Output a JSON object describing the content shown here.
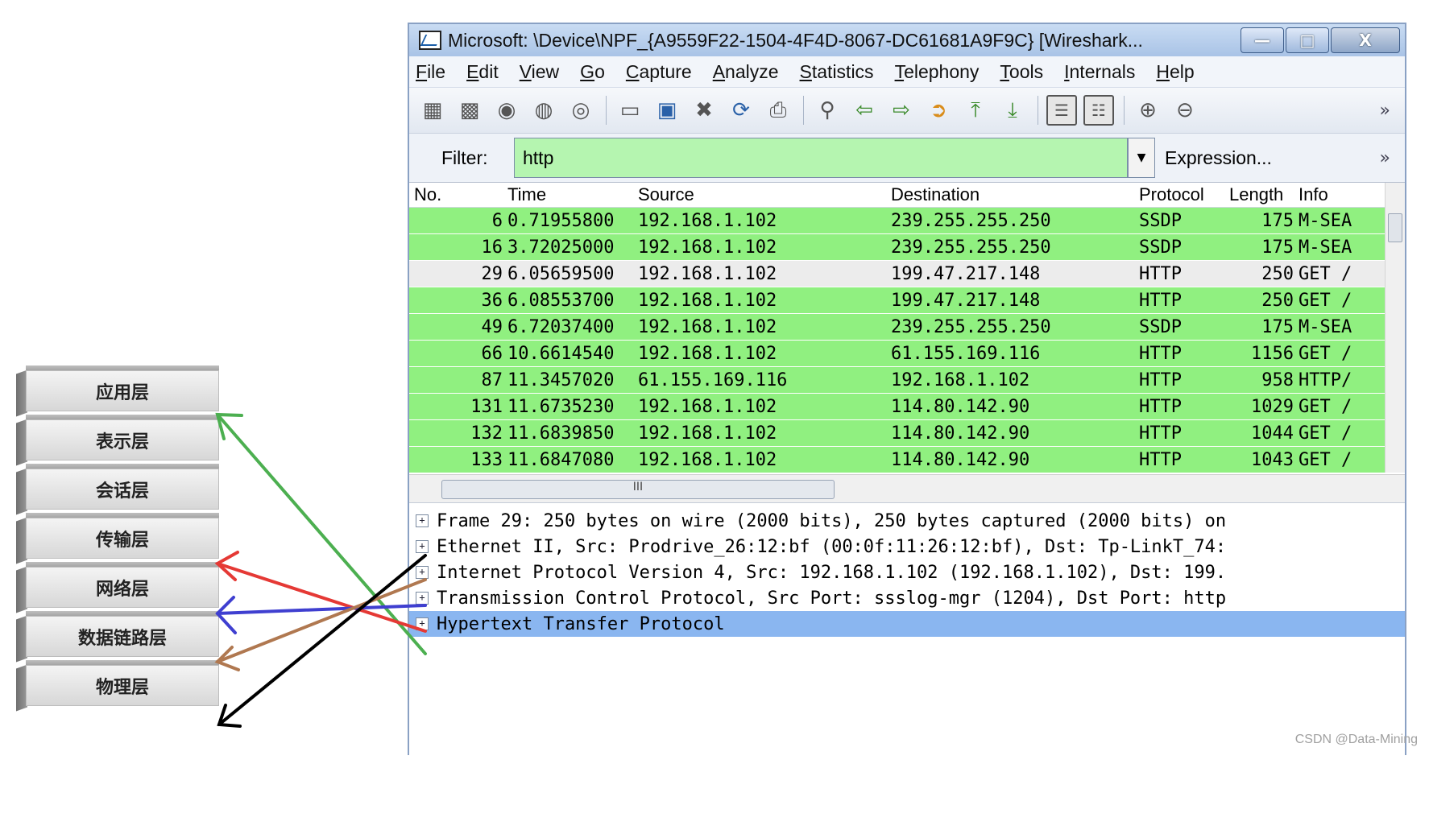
{
  "osi_layers": [
    "应用层",
    "表示层",
    "会话层",
    "传输层",
    "网络层",
    "数据链路层",
    "物理层"
  ],
  "window": {
    "title": "Microsoft: \\Device\\NPF_{A9559F22-1504-4F4D-8067-DC61681A9F9C}  [Wireshark...",
    "buttons": {
      "minimize": "—",
      "maximize": "□",
      "close": "X"
    }
  },
  "menu": [
    "File",
    "Edit",
    "View",
    "Go",
    "Capture",
    "Analyze",
    "Statistics",
    "Telephony",
    "Tools",
    "Internals",
    "Help"
  ],
  "toolbar_more": "»",
  "filter": {
    "label": "Filter:",
    "value": "http",
    "expression": "Expression...",
    "more": "»"
  },
  "columns": [
    "No.",
    "Time",
    "Source",
    "Destination",
    "Protocol",
    "Length",
    "Info"
  ],
  "packets": [
    {
      "no": "6",
      "time": "0.71955800",
      "src": "192.168.1.102",
      "dst": "239.255.255.250",
      "proto": "SSDP",
      "len": "175",
      "info": "M-SEA"
    },
    {
      "no": "16",
      "time": "3.72025000",
      "src": "192.168.1.102",
      "dst": "239.255.255.250",
      "proto": "SSDP",
      "len": "175",
      "info": "M-SEA"
    },
    {
      "no": "29",
      "time": "6.05659500",
      "src": "192.168.1.102",
      "dst": "199.47.217.148",
      "proto": "HTTP",
      "len": "250",
      "info": "GET /"
    },
    {
      "no": "36",
      "time": "6.08553700",
      "src": "192.168.1.102",
      "dst": "199.47.217.148",
      "proto": "HTTP",
      "len": "250",
      "info": "GET /"
    },
    {
      "no": "49",
      "time": "6.72037400",
      "src": "192.168.1.102",
      "dst": "239.255.255.250",
      "proto": "SSDP",
      "len": "175",
      "info": "M-SEA"
    },
    {
      "no": "66",
      "time": "10.6614540",
      "src": "192.168.1.102",
      "dst": "61.155.169.116",
      "proto": "HTTP",
      "len": "1156",
      "info": "GET /"
    },
    {
      "no": "87",
      "time": "11.3457020",
      "src": "61.155.169.116",
      "dst": "192.168.1.102",
      "proto": "HTTP",
      "len": "958",
      "info": "HTTP/"
    },
    {
      "no": "131",
      "time": "11.6735230",
      "src": "192.168.1.102",
      "dst": "114.80.142.90",
      "proto": "HTTP",
      "len": "1029",
      "info": "GET /"
    },
    {
      "no": "132",
      "time": "11.6839850",
      "src": "192.168.1.102",
      "dst": "114.80.142.90",
      "proto": "HTTP",
      "len": "1044",
      "info": "GET /"
    },
    {
      "no": "133",
      "time": "11.6847080",
      "src": "192.168.1.102",
      "dst": "114.80.142.90",
      "proto": "HTTP",
      "len": "1043",
      "info": "GET /"
    }
  ],
  "hscroll_grip": "III",
  "details": [
    "Frame 29: 250 bytes on wire (2000 bits), 250 bytes captured (2000 bits) on",
    "Ethernet II, Src: Prodrive_26:12:bf (00:0f:11:26:12:bf), Dst: Tp-LinkT_74:",
    "Internet Protocol Version 4, Src: 192.168.1.102 (192.168.1.102), Dst: 199.",
    "Transmission Control Protocol, Src Port: ssslog-mgr (1204), Dst Port: http",
    "Hypertext Transfer Protocol"
  ],
  "arrow_colors": {
    "http": "#4caf50",
    "tcp": "#e53935",
    "ip": "#3f3fd0",
    "ethernet": "#b07850",
    "frame": "#000000"
  },
  "watermark": "CSDN @Data-Mining"
}
